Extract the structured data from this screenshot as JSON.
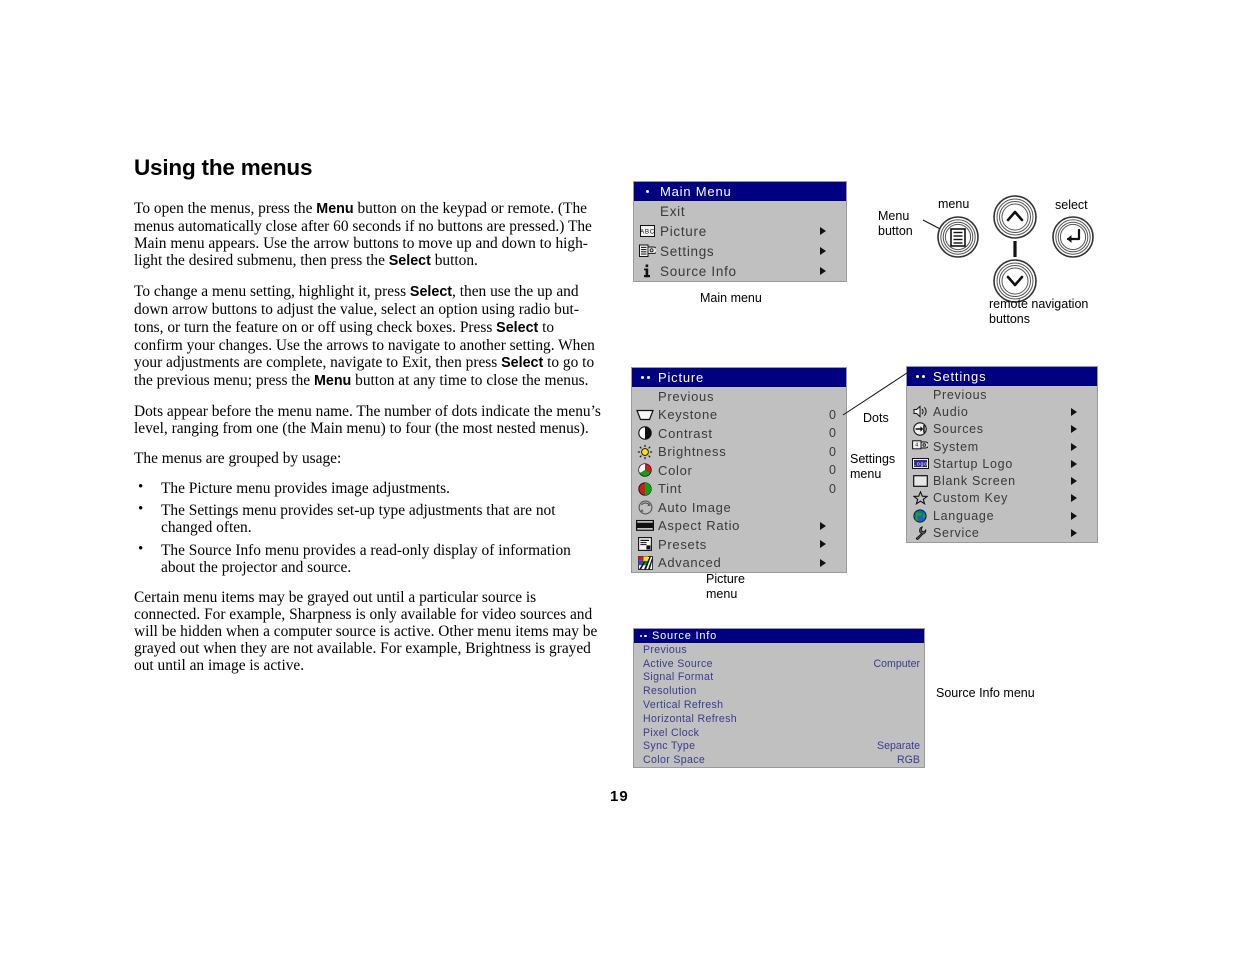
{
  "page": {
    "number": "19"
  },
  "article": {
    "title": "Using the menus",
    "paragraphs": [
      "To open the menus, press the Menu button on the keypad or remote. (The menus automatically close after 60 seconds if no buttons are pressed.) The Main menu appears. Use the arrow buttons to move up and down to highlight the desired submenu, then press the Select button.",
      "To change a menu setting, highlight it, press Select, then use the up and down arrow buttons to adjust the value, select an option using radio buttons, or turn the feature on or off using check boxes. Press Select to confirm your changes. Use the arrows to navigate to another setting. When your adjustments are complete, navigate to Exit, then press Select to go to the previous menu; press the Menu button at any time to close the menus.",
      "Dots appear before the menu name. The number of dots indicate the menu’s level, ranging from one (the Main menu) to four (the most nested menus).",
      "The menus are grouped by usage:"
    ],
    "bullets": [
      "The Picture menu provides image adjustments.",
      "The Settings menu provides set-up type adjustments that are not changed often.",
      "The Source Info menu provides a read-only display of information about the projector and source."
    ],
    "closing": "Certain menu items may be grayed out until a particular source is connected. For example, Sharpness is only available for video sources and will be hidden when a computer source is active. Other menu items may be grayed out when they are not available. For example, Brightness is grayed out until an image is active."
  },
  "colors": {
    "title_bar": "#000080",
    "menu_background": "#c0c0c0",
    "menu_text": "#3a3a3a",
    "source_text": "#3b3b8f"
  },
  "main_menu": {
    "title": "Main Menu",
    "dots": 1,
    "caption": "Main menu",
    "items": [
      {
        "label": "Exit",
        "icon": "none",
        "value": "",
        "arrow": false
      },
      {
        "label": "Picture",
        "icon": "abc-icon",
        "value": "",
        "arrow": true
      },
      {
        "label": "Settings",
        "icon": "sliders-icon",
        "value": "",
        "arrow": true
      },
      {
        "label": "Source Info",
        "icon": "info-icon",
        "value": "",
        "arrow": true
      }
    ]
  },
  "picture_menu": {
    "title": "Picture",
    "dots": 2,
    "caption": "Picture\nmenu",
    "items": [
      {
        "label": "Previous",
        "icon": "none",
        "value": "",
        "arrow": false
      },
      {
        "label": "Keystone",
        "icon": "keystone-icon",
        "value": "0",
        "arrow": false
      },
      {
        "label": "Contrast",
        "icon": "contrast-icon",
        "value": "0",
        "arrow": false
      },
      {
        "label": "Brightness",
        "icon": "brightness-icon",
        "value": "0",
        "arrow": false
      },
      {
        "label": "Color",
        "icon": "color-icon",
        "value": "0",
        "arrow": false
      },
      {
        "label": "Tint",
        "icon": "tint-icon",
        "value": "0",
        "arrow": false
      },
      {
        "label": "Auto Image",
        "icon": "auto-image-icon",
        "value": "",
        "arrow": false
      },
      {
        "label": "Aspect Ratio",
        "icon": "aspect-icon",
        "value": "",
        "arrow": true
      },
      {
        "label": "Presets",
        "icon": "presets-icon",
        "value": "",
        "arrow": true
      },
      {
        "label": "Advanced",
        "icon": "advanced-icon",
        "value": "",
        "arrow": true
      }
    ]
  },
  "settings_menu": {
    "title": "Settings",
    "dots": 2,
    "caption": "Settings\nmenu",
    "dots_caption": "Dots",
    "items": [
      {
        "label": "Previous",
        "icon": "none",
        "value": "",
        "arrow": false
      },
      {
        "label": "Audio",
        "icon": "speaker-icon",
        "value": "",
        "arrow": true
      },
      {
        "label": "Sources",
        "icon": "sources-icon",
        "value": "",
        "arrow": true
      },
      {
        "label": "System",
        "icon": "system-icon",
        "value": "",
        "arrow": true
      },
      {
        "label": "Startup Logo",
        "icon": "logo-icon",
        "value": "",
        "arrow": true
      },
      {
        "label": "Blank Screen",
        "icon": "blank-icon",
        "value": "",
        "arrow": true
      },
      {
        "label": "Custom Key",
        "icon": "star-icon",
        "value": "",
        "arrow": true
      },
      {
        "label": "Language",
        "icon": "globe-icon",
        "value": "",
        "arrow": true
      },
      {
        "label": "Service",
        "icon": "wrench-icon",
        "value": "",
        "arrow": true
      }
    ]
  },
  "source_info_menu": {
    "title": "Source Info",
    "dots": 2,
    "caption": "Source Info menu",
    "items": [
      {
        "label": "Previous",
        "value": ""
      },
      {
        "label": "Active Source",
        "value": "Computer"
      },
      {
        "label": "Signal Format",
        "value": ""
      },
      {
        "label": "Resolution",
        "value": ""
      },
      {
        "label": "Vertical Refresh",
        "value": ""
      },
      {
        "label": "Horizontal Refresh",
        "value": ""
      },
      {
        "label": "Pixel Clock",
        "value": ""
      },
      {
        "label": "Sync Type",
        "value": "Separate"
      },
      {
        "label": "Color Space",
        "value": "RGB"
      }
    ]
  },
  "remote_diagram": {
    "menu_button_label": "Menu\nbutton",
    "menu_label": "menu",
    "select_label": "select",
    "remote_nav_label": "remote navigation\nbuttons"
  }
}
